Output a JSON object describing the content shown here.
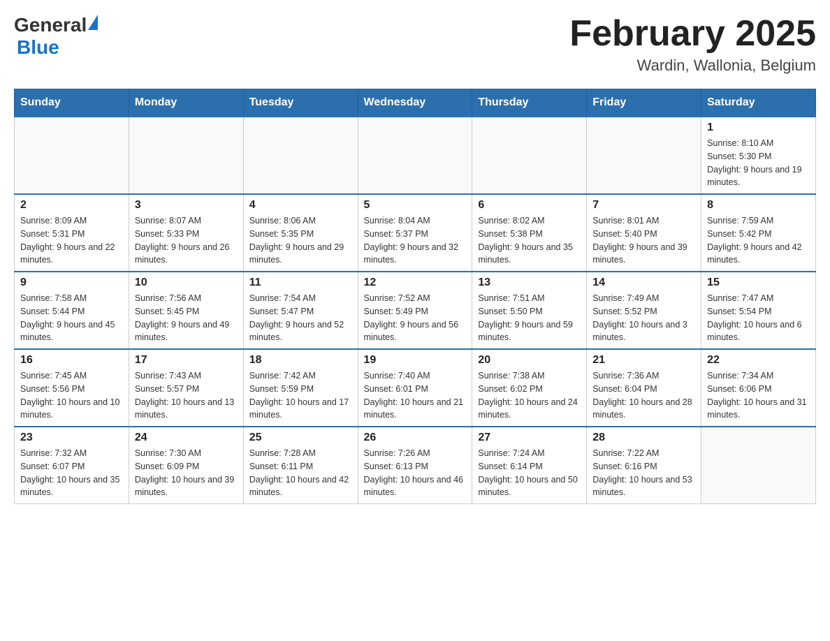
{
  "header": {
    "logo_general": "General",
    "logo_blue": "Blue",
    "month_title": "February 2025",
    "location": "Wardin, Wallonia, Belgium"
  },
  "days_of_week": [
    "Sunday",
    "Monday",
    "Tuesday",
    "Wednesday",
    "Thursday",
    "Friday",
    "Saturday"
  ],
  "weeks": [
    [
      {
        "day": "",
        "info": ""
      },
      {
        "day": "",
        "info": ""
      },
      {
        "day": "",
        "info": ""
      },
      {
        "day": "",
        "info": ""
      },
      {
        "day": "",
        "info": ""
      },
      {
        "day": "",
        "info": ""
      },
      {
        "day": "1",
        "info": "Sunrise: 8:10 AM\nSunset: 5:30 PM\nDaylight: 9 hours and 19 minutes."
      }
    ],
    [
      {
        "day": "2",
        "info": "Sunrise: 8:09 AM\nSunset: 5:31 PM\nDaylight: 9 hours and 22 minutes."
      },
      {
        "day": "3",
        "info": "Sunrise: 8:07 AM\nSunset: 5:33 PM\nDaylight: 9 hours and 26 minutes."
      },
      {
        "day": "4",
        "info": "Sunrise: 8:06 AM\nSunset: 5:35 PM\nDaylight: 9 hours and 29 minutes."
      },
      {
        "day": "5",
        "info": "Sunrise: 8:04 AM\nSunset: 5:37 PM\nDaylight: 9 hours and 32 minutes."
      },
      {
        "day": "6",
        "info": "Sunrise: 8:02 AM\nSunset: 5:38 PM\nDaylight: 9 hours and 35 minutes."
      },
      {
        "day": "7",
        "info": "Sunrise: 8:01 AM\nSunset: 5:40 PM\nDaylight: 9 hours and 39 minutes."
      },
      {
        "day": "8",
        "info": "Sunrise: 7:59 AM\nSunset: 5:42 PM\nDaylight: 9 hours and 42 minutes."
      }
    ],
    [
      {
        "day": "9",
        "info": "Sunrise: 7:58 AM\nSunset: 5:44 PM\nDaylight: 9 hours and 45 minutes."
      },
      {
        "day": "10",
        "info": "Sunrise: 7:56 AM\nSunset: 5:45 PM\nDaylight: 9 hours and 49 minutes."
      },
      {
        "day": "11",
        "info": "Sunrise: 7:54 AM\nSunset: 5:47 PM\nDaylight: 9 hours and 52 minutes."
      },
      {
        "day": "12",
        "info": "Sunrise: 7:52 AM\nSunset: 5:49 PM\nDaylight: 9 hours and 56 minutes."
      },
      {
        "day": "13",
        "info": "Sunrise: 7:51 AM\nSunset: 5:50 PM\nDaylight: 9 hours and 59 minutes."
      },
      {
        "day": "14",
        "info": "Sunrise: 7:49 AM\nSunset: 5:52 PM\nDaylight: 10 hours and 3 minutes."
      },
      {
        "day": "15",
        "info": "Sunrise: 7:47 AM\nSunset: 5:54 PM\nDaylight: 10 hours and 6 minutes."
      }
    ],
    [
      {
        "day": "16",
        "info": "Sunrise: 7:45 AM\nSunset: 5:56 PM\nDaylight: 10 hours and 10 minutes."
      },
      {
        "day": "17",
        "info": "Sunrise: 7:43 AM\nSunset: 5:57 PM\nDaylight: 10 hours and 13 minutes."
      },
      {
        "day": "18",
        "info": "Sunrise: 7:42 AM\nSunset: 5:59 PM\nDaylight: 10 hours and 17 minutes."
      },
      {
        "day": "19",
        "info": "Sunrise: 7:40 AM\nSunset: 6:01 PM\nDaylight: 10 hours and 21 minutes."
      },
      {
        "day": "20",
        "info": "Sunrise: 7:38 AM\nSunset: 6:02 PM\nDaylight: 10 hours and 24 minutes."
      },
      {
        "day": "21",
        "info": "Sunrise: 7:36 AM\nSunset: 6:04 PM\nDaylight: 10 hours and 28 minutes."
      },
      {
        "day": "22",
        "info": "Sunrise: 7:34 AM\nSunset: 6:06 PM\nDaylight: 10 hours and 31 minutes."
      }
    ],
    [
      {
        "day": "23",
        "info": "Sunrise: 7:32 AM\nSunset: 6:07 PM\nDaylight: 10 hours and 35 minutes."
      },
      {
        "day": "24",
        "info": "Sunrise: 7:30 AM\nSunset: 6:09 PM\nDaylight: 10 hours and 39 minutes."
      },
      {
        "day": "25",
        "info": "Sunrise: 7:28 AM\nSunset: 6:11 PM\nDaylight: 10 hours and 42 minutes."
      },
      {
        "day": "26",
        "info": "Sunrise: 7:26 AM\nSunset: 6:13 PM\nDaylight: 10 hours and 46 minutes."
      },
      {
        "day": "27",
        "info": "Sunrise: 7:24 AM\nSunset: 6:14 PM\nDaylight: 10 hours and 50 minutes."
      },
      {
        "day": "28",
        "info": "Sunrise: 7:22 AM\nSunset: 6:16 PM\nDaylight: 10 hours and 53 minutes."
      },
      {
        "day": "",
        "info": ""
      }
    ]
  ]
}
